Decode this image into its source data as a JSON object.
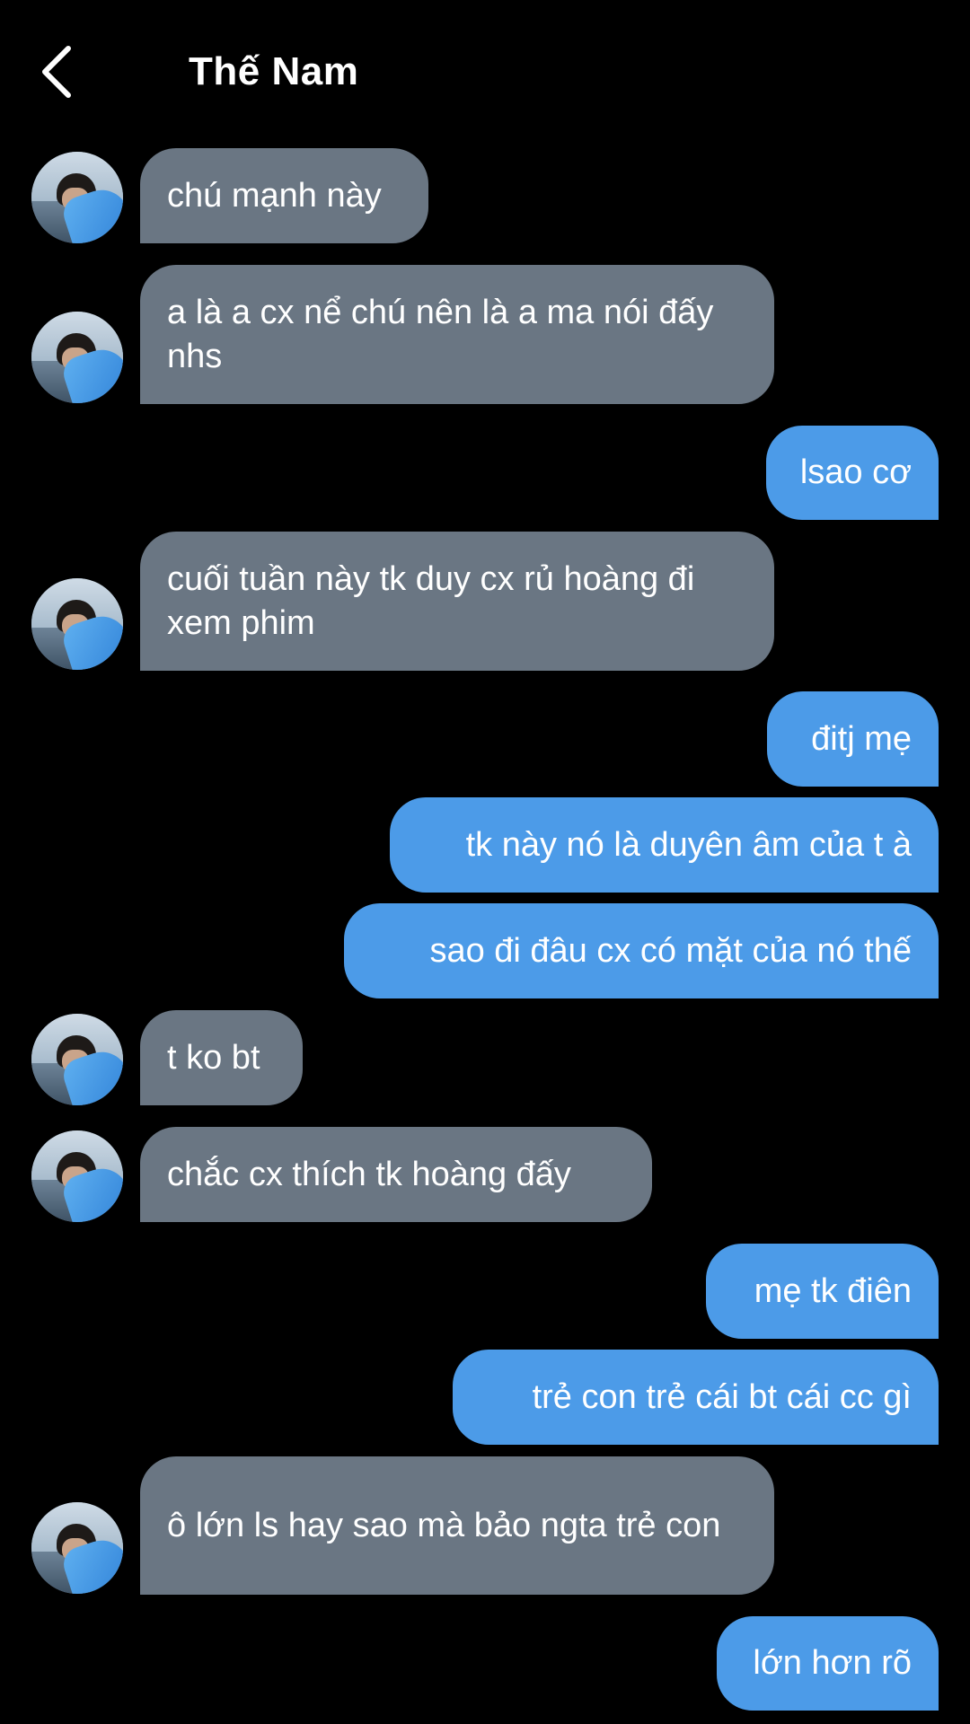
{
  "header": {
    "title": "Thế Nam",
    "back_icon": "chevron-left-icon"
  },
  "colors": {
    "background": "#000000",
    "incoming_bubble": "#6a7683",
    "outgoing_bubble": "#4c9be8",
    "text": "#ffffff"
  },
  "messages": [
    {
      "direction": "in",
      "text": "chú mạnh này"
    },
    {
      "direction": "in",
      "text": "a là a cx nể chú nên là a ma nói đấy nhs"
    },
    {
      "direction": "out",
      "text": "lsao cơ"
    },
    {
      "direction": "in",
      "text": "cuối tuần này tk duy cx rủ hoàng đi xem phim"
    },
    {
      "direction": "out",
      "text": "đitj mẹ"
    },
    {
      "direction": "out",
      "text": "tk này nó là duyên âm của t à"
    },
    {
      "direction": "out",
      "text": "sao đi đâu cx có mặt của nó thế"
    },
    {
      "direction": "in",
      "text": "t ko bt"
    },
    {
      "direction": "in",
      "text": "chắc cx thích tk hoàng đấy"
    },
    {
      "direction": "out",
      "text": "mẹ tk điên"
    },
    {
      "direction": "out",
      "text": "trẻ con trẻ cái bt cái cc gì"
    },
    {
      "direction": "in",
      "text": "ô lớn ls hay sao mà bảo ngta trẻ con"
    },
    {
      "direction": "out",
      "text": "lớn hơn rõ"
    }
  ]
}
